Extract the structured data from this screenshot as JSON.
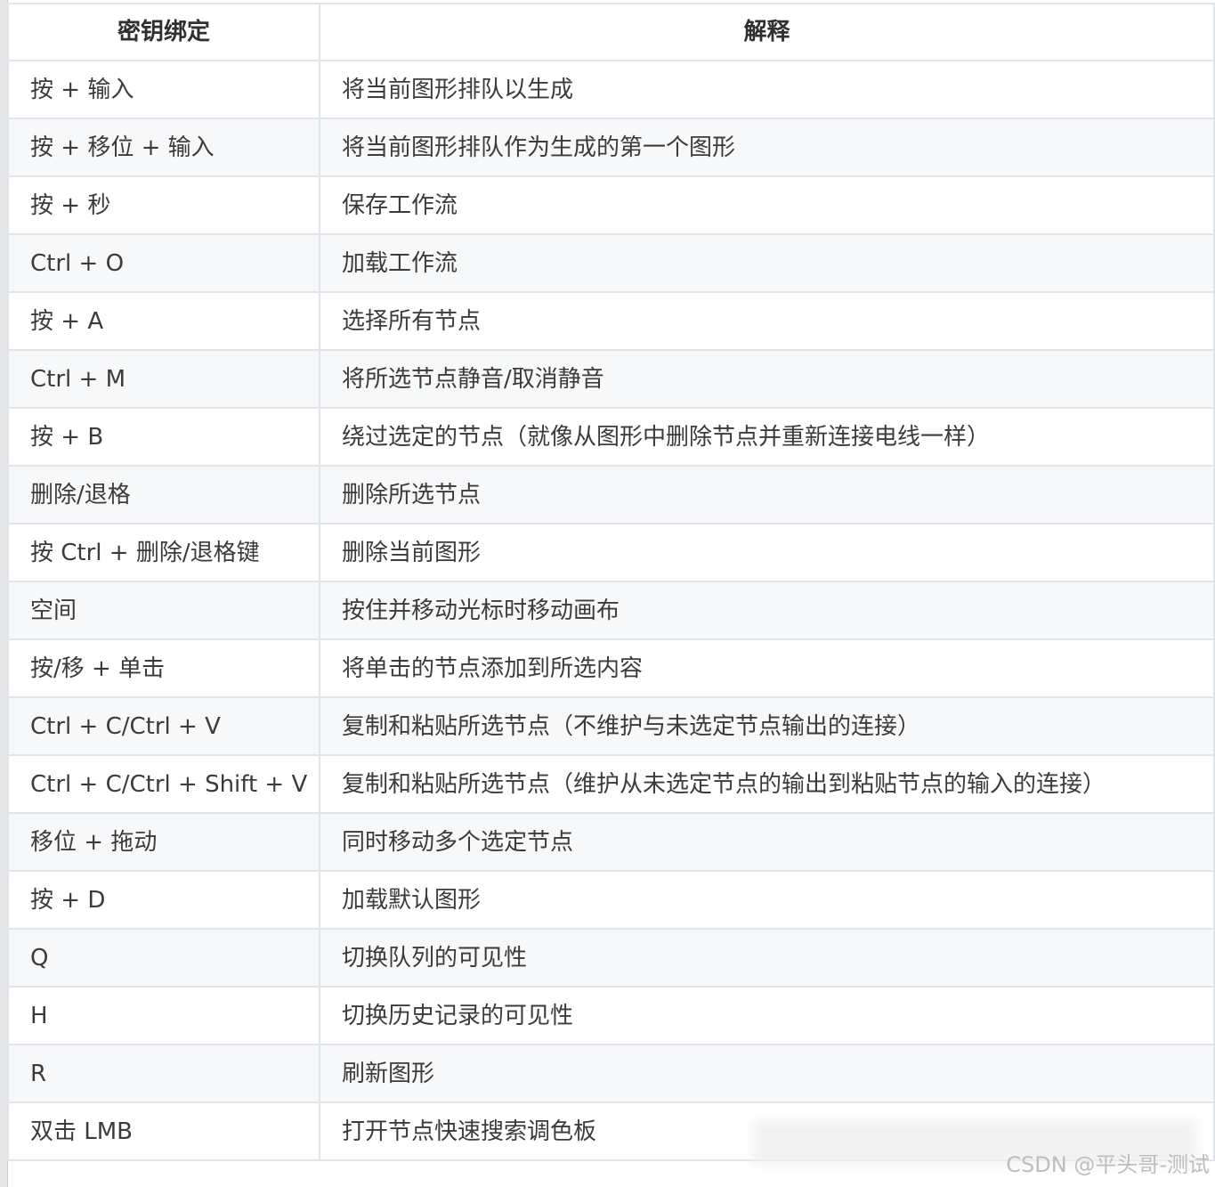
{
  "table": {
    "headers": [
      "密钥绑定",
      "解释"
    ],
    "rows": [
      [
        "按 + 输入",
        "将当前图形排队以生成"
      ],
      [
        "按 + 移位 + 输入",
        "将当前图形排队作为生成的第一个图形"
      ],
      [
        "按 + 秒",
        "保存工作流"
      ],
      [
        "Ctrl + O",
        "加载工作流"
      ],
      [
        "按 + A",
        "选择所有节点"
      ],
      [
        "Ctrl + M",
        "将所选节点静音/取消静音"
      ],
      [
        "按 + B",
        "绕过选定的节点（就像从图形中删除节点并重新连接电线一样）"
      ],
      [
        "删除/退格",
        "删除所选节点"
      ],
      [
        "按 Ctrl + 删除/退格键",
        "删除当前图形"
      ],
      [
        "空间",
        "按住并移动光标时移动画布"
      ],
      [
        "按/移 + 单击",
        "将单击的节点添加到所选内容"
      ],
      [
        "Ctrl + C/Ctrl + V",
        "复制和粘贴所选节点（不维护与未选定节点输出的连接）"
      ],
      [
        "Ctrl + C/Ctrl + Shift + V",
        "复制和粘贴所选节点（维护从未选定节点的输出到粘贴节点的输入的连接）"
      ],
      [
        "移位 + 拖动",
        "同时移动多个选定节点"
      ],
      [
        "按 + D",
        "加载默认图形"
      ],
      [
        "Q",
        "切换队列的可见性"
      ],
      [
        "H",
        "切换历史记录的可见性"
      ],
      [
        "R",
        "刷新图形"
      ],
      [
        "双击 LMB",
        "打开节点快速搜索调色板"
      ]
    ]
  },
  "watermark": "CSDN @平头哥-测试"
}
